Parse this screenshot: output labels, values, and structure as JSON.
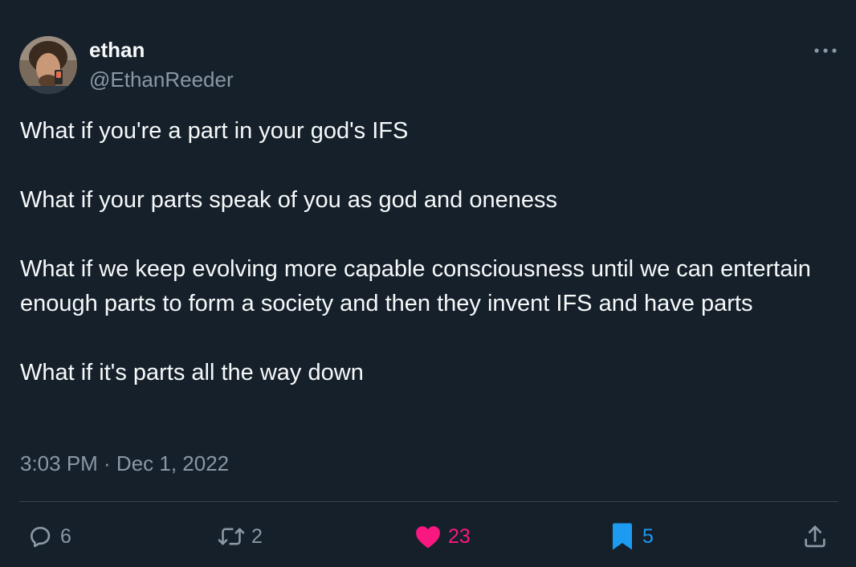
{
  "author": {
    "display_name": "ethan",
    "handle": "@EthanReeder"
  },
  "tweet": {
    "paragraphs": [
      "What if you're a part in your god's IFS",
      "What if your parts speak of you as god and oneness",
      "What if we keep evolving more capable consciousness until we can entertain enough parts to form a society and then they invent IFS and have parts",
      "What if it's parts all the way down"
    ],
    "timestamp": "3:03 PM · Dec 1, 2022"
  },
  "actions": {
    "replies": "6",
    "retweets": "2",
    "likes": "23",
    "bookmarks": "5"
  },
  "icons": {
    "more": "more-horizontal-icon",
    "reply": "reply-icon",
    "retweet": "retweet-icon",
    "like": "heart-icon",
    "bookmark": "bookmark-icon",
    "share": "share-icon"
  },
  "colors": {
    "background": "#15202b",
    "text_primary": "#f7f9f9",
    "text_secondary": "#8b98a5",
    "like": "#f91880",
    "bookmark": "#1d9bf0",
    "divider": "#38444d"
  }
}
